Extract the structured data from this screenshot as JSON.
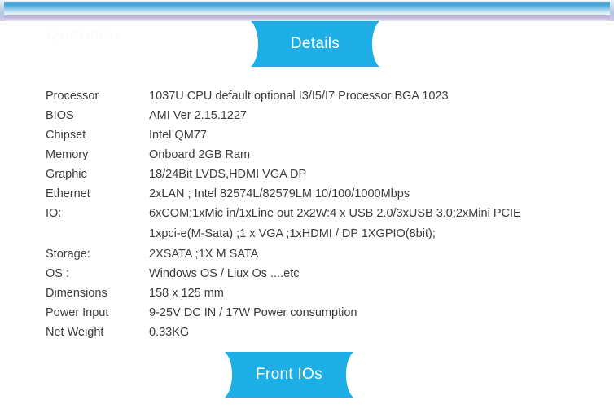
{
  "top_bar": {
    "name": "decorative-header-bar",
    "gradient_top": "#3f9fd4",
    "gradient_bottom": "#eef6fc",
    "shadow_color": "#bdb4da"
  },
  "watermark": {
    "text": "Quanmax"
  },
  "banners": {
    "details": {
      "label": "Details",
      "color": "#1eaee6",
      "text_color": "#ffffff"
    },
    "front_ios": {
      "label": "Front IOs",
      "color": "#1eaee6",
      "text_color": "#ffffff"
    }
  },
  "spec_table": {
    "rows": [
      {
        "label": "Processor",
        "value": "1037U CPU default optional I3/I5/I7 Processor BGA 1023"
      },
      {
        "label": "BIOS",
        "value": "AMI Ver 2.15.1227"
      },
      {
        "label": "Chipset",
        "value": "Intel QM77"
      },
      {
        "label": "Memory",
        "value": "Onboard 2GB Ram"
      },
      {
        "label": "Graphic",
        "value": "18/24Bit LVDS,HDMI VGA DP"
      },
      {
        "label": "Ethernet",
        "value": "2xLAN ; Intel 82574L/82579LM 10/100/1000Mbps"
      },
      {
        "label": "IO:",
        "value": "6xCOM;1xMic in/1xLine out 2x2W:4 x USB 2.0/3xUSB 3.0;2xMini PCIE"
      },
      {
        "label": "",
        "value": "1xpci-e(M-Sata) ;1 x VGA ;1xHDMI / DP 1XGPIO(8bit);"
      },
      {
        "label": "Storage:",
        "value": "2XSATA ;1X M SATA"
      },
      {
        "label": "OS :",
        "value": "Windows OS / Liux Os ....etc"
      },
      {
        "label": "Dimensions",
        "value": "158 x 125 mm"
      },
      {
        "label": "Power Input",
        "value": "9-25V DC IN / 17W Power consumption"
      },
      {
        "label": "Net Weight",
        "value": "0.33KG"
      }
    ]
  }
}
